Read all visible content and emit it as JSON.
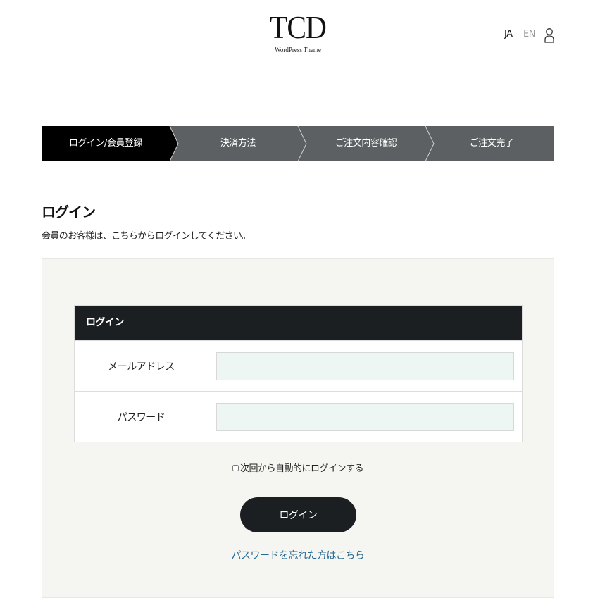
{
  "header": {
    "logo_main": "TCD",
    "logo_sub": "WordPress Theme",
    "lang_ja": "JA",
    "lang_en": "EN",
    "user_icon": "user-icon"
  },
  "steps": [
    {
      "label": "ログイン/会員登録",
      "active": true
    },
    {
      "label": "決済方法",
      "active": false
    },
    {
      "label": "ご注文内容確認",
      "active": false
    },
    {
      "label": "ご注文完了",
      "active": false
    }
  ],
  "colors": {
    "step_active": "#000000",
    "step_inactive": "#5d6062",
    "dark": "#1c1f22",
    "panel_bg": "#f5f5f2",
    "link": "#2a6a91"
  },
  "main": {
    "title": "ログイン",
    "intro": "会員のお客様は、こちらからログインしてください。"
  },
  "form": {
    "table_title": "ログイン",
    "email_label": "メールアドレス",
    "email_value": "",
    "password_label": "パスワード",
    "password_value": "",
    "remember_label": "次回から自動的にログインする",
    "submit_label": "ログイン",
    "forgot_link": "パスワードを忘れた方はこちら"
  }
}
